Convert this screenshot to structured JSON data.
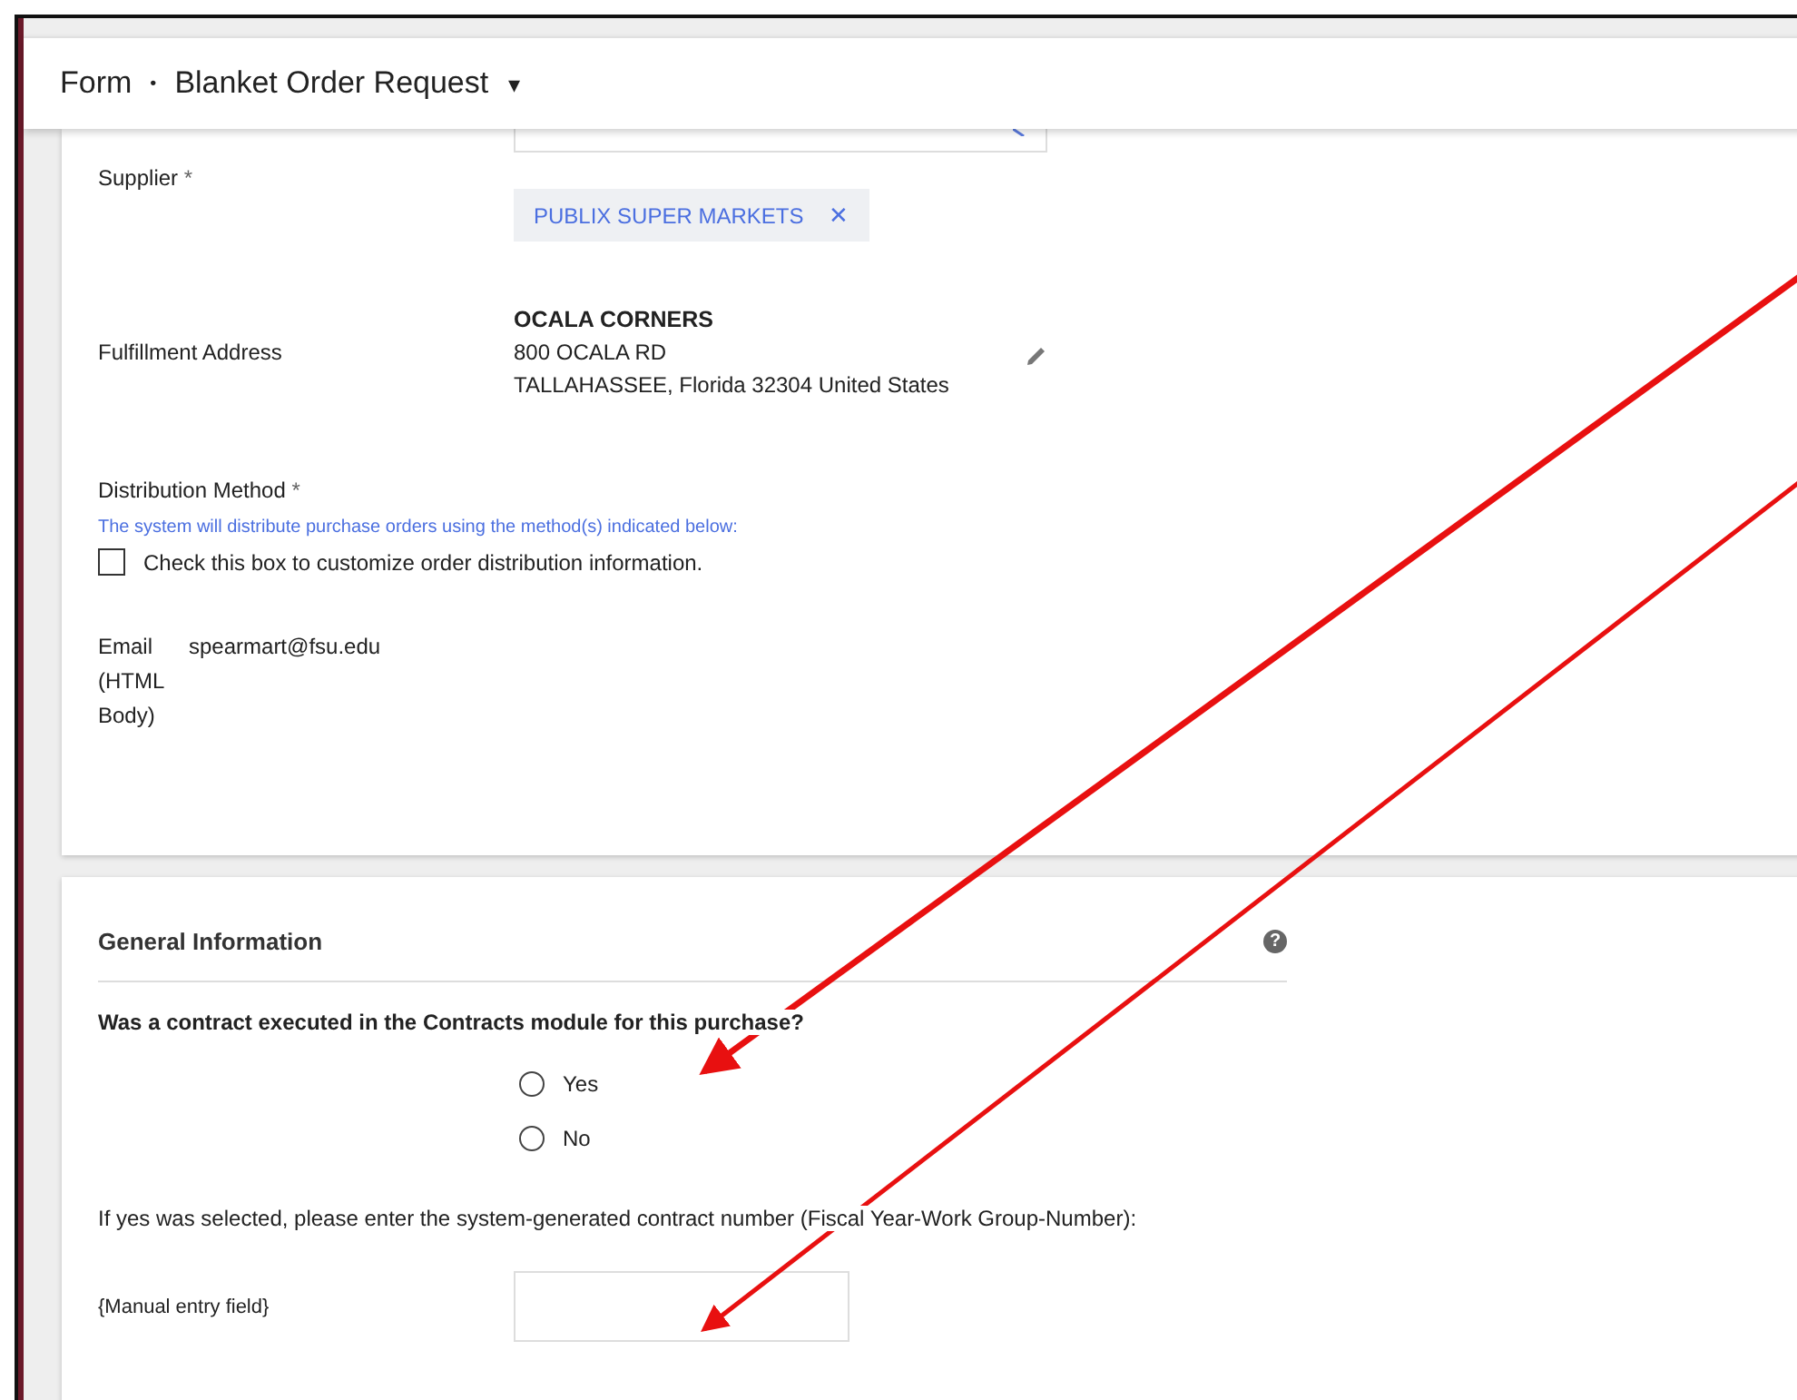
{
  "header": {
    "form_label": "Form",
    "separator": "•",
    "title": "Blanket Order Request",
    "caret": "▾"
  },
  "supplier": {
    "label": "Supplier",
    "required_mark": "*",
    "chip": "PUBLIX SUPER MARKETS",
    "chip_remove": "✕"
  },
  "fulfillment": {
    "label": "Fulfillment Address",
    "name": "OCALA CORNERS",
    "street": "800 OCALA RD",
    "city_line": "TALLAHASSEE, Florida 32304 United States"
  },
  "distribution": {
    "label": "Distribution Method",
    "required_mark": "*",
    "note": "The system will distribute purchase orders using the method(s) indicated below:",
    "checkbox_label": "Check this box to customize order distribution information.",
    "checked": false,
    "method_label": "Email (HTML Body)",
    "method_value": "spearmart@fsu.edu"
  },
  "general": {
    "title": "General Information",
    "help": "?",
    "question": "Was a contract executed in the Contracts module for this purchase?",
    "options": [
      {
        "label": "Yes",
        "selected": false
      },
      {
        "label": "No",
        "selected": false
      }
    ],
    "instruction": "If yes was selected, please enter the system-generated contract number (Fiscal Year-Work Group-Number):",
    "entry_label": "{Manual entry field}"
  }
}
